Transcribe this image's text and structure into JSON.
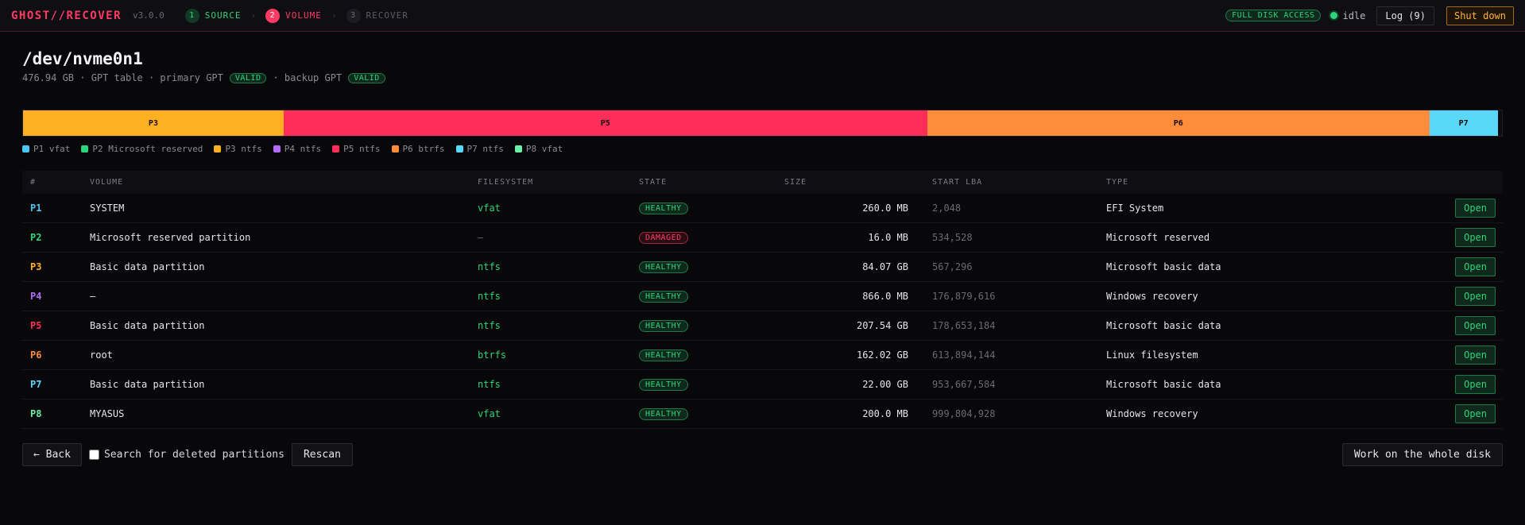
{
  "app": {
    "logo": "GHOST//RECOVER",
    "version": "v3.0.0",
    "steps": [
      {
        "num": "1",
        "label": "SOURCE",
        "state": "done"
      },
      {
        "num": "2",
        "label": "VOLUME",
        "state": "active"
      },
      {
        "num": "3",
        "label": "RECOVER",
        "state": "pending"
      }
    ],
    "step_separator": "›",
    "access_badge": "FULL DISK ACCESS",
    "status_text": "idle",
    "log_label": "Log (9)",
    "shutdown_label": "Shut down"
  },
  "disk": {
    "device": "/dev/nvme0n1",
    "size_info": "476.94 GB · GPT table · primary GPT",
    "primary_badge": "VALID",
    "backup_label": "· backup GPT",
    "backup_badge": "VALID"
  },
  "partitions_bar": [
    {
      "label": "P3",
      "color": "#ffb020",
      "fraction": 0.1762
    },
    {
      "label": "P5",
      "color": "#ff2d5a",
      "fraction": 0.4351
    },
    {
      "label": "P6",
      "color": "#ff8c3a",
      "fraction": 0.3397
    },
    {
      "label": "P7",
      "color": "#5ad8f8",
      "fraction": 0.0461
    }
  ],
  "legend": [
    {
      "text": "P1 vfat",
      "color": "#4ac6f0"
    },
    {
      "text": "P2 Microsoft reserved",
      "color": "#2ed47a"
    },
    {
      "text": "P3 ntfs",
      "color": "#ffb020"
    },
    {
      "text": "P4 ntfs",
      "color": "#b26cf8"
    },
    {
      "text": "P5 ntfs",
      "color": "#ff2d5a"
    },
    {
      "text": "P6 btrfs",
      "color": "#ff8c3a"
    },
    {
      "text": "P7 ntfs",
      "color": "#5ad8f8"
    },
    {
      "text": "P8 vfat",
      "color": "#6cf0a8"
    }
  ],
  "table": {
    "headers": [
      "#",
      "VOLUME",
      "FILESYSTEM",
      "STATE",
      "SIZE",
      "START LBA",
      "TYPE",
      ""
    ],
    "rows": [
      {
        "id": "P1",
        "color": "#4ac6f0",
        "volume": "SYSTEM",
        "fs": "vfat",
        "state": "HEALTHY",
        "size": "260.0 MB",
        "lba": "2,048",
        "type": "EFI System",
        "action": "Open"
      },
      {
        "id": "P2",
        "color": "#2ed47a",
        "volume": "Microsoft reserved partition",
        "fs": "—",
        "state": "DAMAGED",
        "size": "16.0 MB",
        "lba": "534,528",
        "type": "Microsoft reserved",
        "action": "Open"
      },
      {
        "id": "P3",
        "color": "#ffb020",
        "volume": "Basic data partition",
        "fs": "ntfs",
        "state": "HEALTHY",
        "size": "84.07 GB",
        "lba": "567,296",
        "type": "Microsoft basic data",
        "action": "Open"
      },
      {
        "id": "P4",
        "color": "#b26cf8",
        "volume": "—",
        "fs": "ntfs",
        "state": "HEALTHY",
        "size": "866.0 MB",
        "lba": "176,879,616",
        "type": "Windows recovery",
        "action": "Open"
      },
      {
        "id": "P5",
        "color": "#ff2d5a",
        "volume": "Basic data partition",
        "fs": "ntfs",
        "state": "HEALTHY",
        "size": "207.54 GB",
        "lba": "178,653,184",
        "type": "Microsoft basic data",
        "action": "Open"
      },
      {
        "id": "P6",
        "color": "#ff8c3a",
        "volume": "root",
        "fs": "btrfs",
        "state": "HEALTHY",
        "size": "162.02 GB",
        "lba": "613,894,144",
        "type": "Linux filesystem",
        "action": "Open"
      },
      {
        "id": "P7",
        "color": "#5ad8f8",
        "volume": "Basic data partition",
        "fs": "ntfs",
        "state": "HEALTHY",
        "size": "22.00 GB",
        "lba": "953,667,584",
        "type": "Microsoft basic data",
        "action": "Open"
      },
      {
        "id": "P8",
        "color": "#6cf0a8",
        "volume": "MYASUS",
        "fs": "vfat",
        "state": "HEALTHY",
        "size": "200.0 MB",
        "lba": "999,804,928",
        "type": "Windows recovery",
        "action": "Open"
      }
    ]
  },
  "footer": {
    "back_label": "← Back",
    "deleted_search_label": "Search for deleted partitions",
    "deleted_search_checked": false,
    "rescan_label": "Rescan",
    "whole_disk_label": "Work on the whole disk"
  }
}
